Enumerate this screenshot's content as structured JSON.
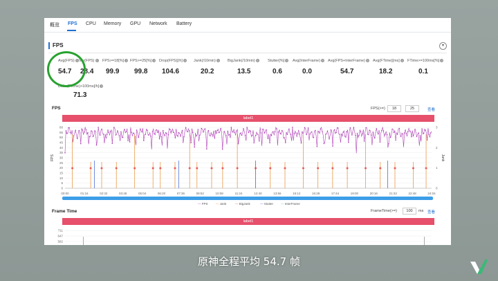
{
  "tabs": [
    {
      "label": "概览",
      "active": false
    },
    {
      "label": "FPS",
      "active": true
    },
    {
      "label": "CPU",
      "active": false
    },
    {
      "label": "Memory",
      "active": false
    },
    {
      "label": "GPU",
      "active": false
    },
    {
      "label": "Network",
      "active": false
    },
    {
      "label": "Battery",
      "active": false
    }
  ],
  "section": {
    "title": "FPS",
    "collapse_icon": "chevron-down-icon"
  },
  "metrics": [
    {
      "label": "Avg(FPS)",
      "value": "54.7"
    },
    {
      "label": "Var(FPS)",
      "value": "28.4"
    },
    {
      "label": "FPS>=18[%]",
      "value": "99.9"
    },
    {
      "label": "FPS>=25[%]",
      "value": "99.8"
    },
    {
      "label": "Drop(FPS)[/h]",
      "value": "104.6"
    },
    {
      "label": "Jank(/10min)",
      "value": "20.2"
    },
    {
      "label": "BigJank(/10min)",
      "value": "13.5"
    },
    {
      "label": "Stutter[%]",
      "value": "0.6"
    },
    {
      "label": "Avg(InterFrame)",
      "value": "0.0"
    },
    {
      "label": "Avg(FPS+InterFrame)",
      "value": "54.7"
    },
    {
      "label": "Avg(FTime)[ms]",
      "value": "18.2"
    },
    {
      "label": "FTime>=100ms[%]",
      "value": "0.1"
    },
    {
      "label": "Delta(FTime)>100ms[/h]",
      "value": "71.3"
    }
  ],
  "fps_chart": {
    "title": "FPS",
    "control_label": "FPS(>=)",
    "control_values": [
      "18",
      "25"
    ],
    "control_link": "查看",
    "label_bar": "label1",
    "y_axis_label": "FPS",
    "y2_axis_label": "Jank",
    "y_ticks": [
      "60",
      "55",
      "50",
      "45",
      "40",
      "35",
      "30",
      "25",
      "20",
      "15",
      "10",
      "5",
      "0"
    ],
    "y2_ticks": [
      "3",
      "2",
      "1",
      "0"
    ],
    "x_ticks": [
      "00:00",
      "01:16",
      "02:32",
      "03:48",
      "05:04",
      "06:20",
      "07:36",
      "08:52",
      "10:08",
      "11:24",
      "12:40",
      "13:56",
      "15:12",
      "16:28",
      "17:44",
      "19:00",
      "20:16",
      "21:32",
      "22:48",
      "24:04"
    ],
    "legend": [
      "FPS",
      "Jank",
      "BigJank",
      "Stutter",
      "InterFrame"
    ],
    "colors": {
      "fps": "#b03fb8",
      "jank": "#e88b2e",
      "bigjank": "#e85b5b",
      "stutter": "#4f6fd9",
      "interframe": "#5fb8c9"
    }
  },
  "frame_time_chart": {
    "title": "Frame Time",
    "control_label": "FrameTime(>=)",
    "control_value": "100",
    "control_unit": "ms",
    "control_link": "查看",
    "label_bar": "label1",
    "y_ticks": [
      "711",
      "647",
      "582"
    ]
  },
  "subtitle": "原神全程平均 54.7 帧"
}
